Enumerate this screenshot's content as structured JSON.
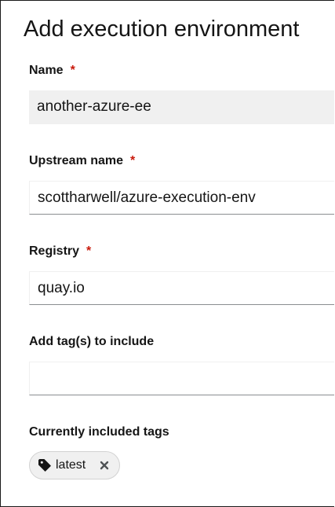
{
  "page": {
    "title": "Add execution environment"
  },
  "form": {
    "name": {
      "label": "Name",
      "required_marker": "*",
      "value": "another-azure-ee"
    },
    "upstream_name": {
      "label": "Upstream name",
      "required_marker": "*",
      "value": "scottharwell/azure-execution-env"
    },
    "registry": {
      "label": "Registry",
      "required_marker": "*",
      "value": "quay.io"
    },
    "add_tags": {
      "label": "Add tag(s) to include",
      "value": ""
    },
    "included_tags": {
      "label": "Currently included tags",
      "tags": [
        {
          "label": "latest",
          "icon": "tag-icon",
          "remove_icon": "close-icon"
        }
      ]
    }
  },
  "colors": {
    "required": "#c9190b",
    "readonly_bg": "#f0f0f0",
    "input_bottom_border": "#8a8d90",
    "chip_border": "#d2d2d2"
  }
}
